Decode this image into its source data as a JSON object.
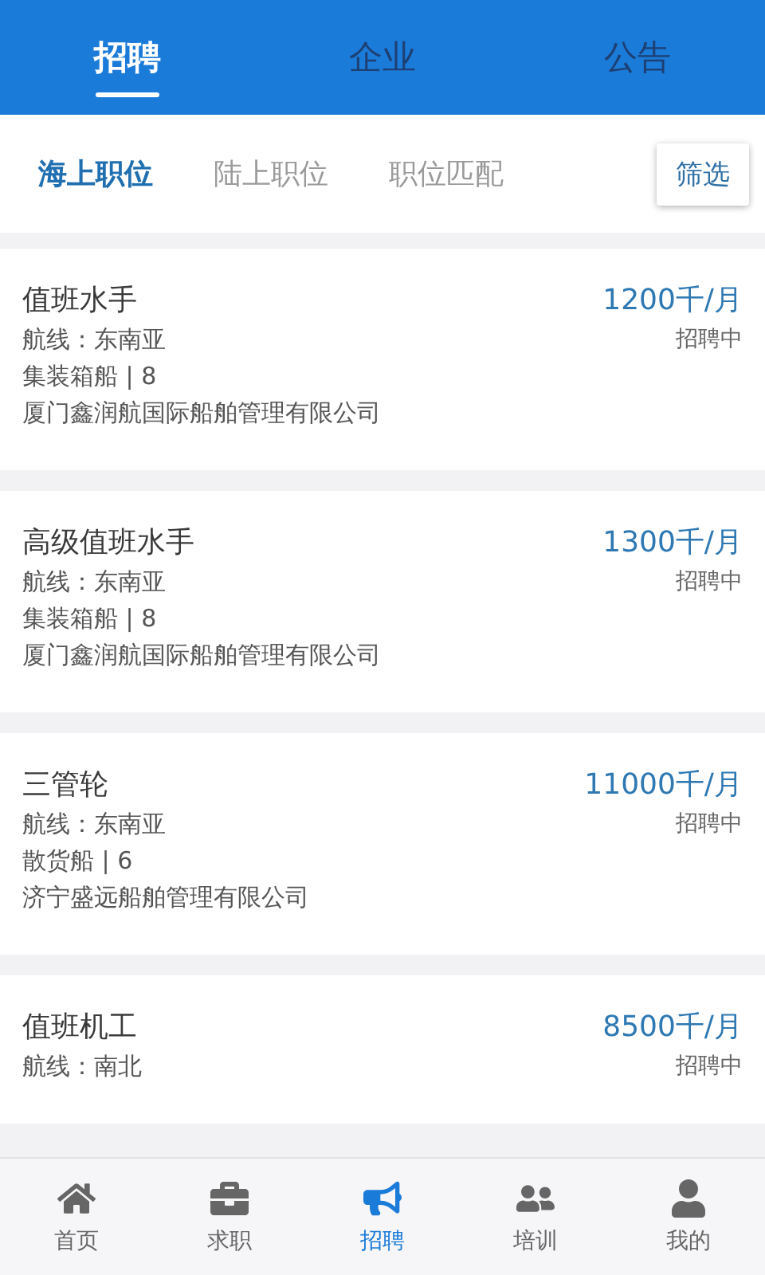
{
  "top_tabs": [
    {
      "label": "招聘",
      "selected": true
    },
    {
      "label": "企业",
      "selected": false
    },
    {
      "label": "公告",
      "selected": false
    }
  ],
  "sub_tabs": [
    {
      "label": "海上职位",
      "selected": true
    },
    {
      "label": "陆上职位",
      "selected": false
    },
    {
      "label": "职位匹配",
      "selected": false
    }
  ],
  "filter_button": "筛选",
  "jobs": [
    {
      "title": "值班水手",
      "salary": "1200千/月",
      "route": "航线：东南亚",
      "status": "招聘中",
      "vessel": "集装箱船 | 8",
      "company": "厦门鑫润航国际船舶管理有限公司"
    },
    {
      "title": "高级值班水手",
      "salary": "1300千/月",
      "route": "航线：东南亚",
      "status": "招聘中",
      "vessel": "集装箱船 | 8",
      "company": "厦门鑫润航国际船舶管理有限公司"
    },
    {
      "title": "三管轮",
      "salary": "11000千/月",
      "route": "航线：东南亚",
      "status": "招聘中",
      "vessel": "散货船 | 6",
      "company": "济宁盛远船舶管理有限公司"
    },
    {
      "title": "值班机工",
      "salary": "8500千/月",
      "route": "航线：南北",
      "status": "招聘中"
    }
  ],
  "bottom_nav": [
    {
      "label": "首页",
      "kind": "home",
      "selected": false
    },
    {
      "label": "求职",
      "kind": "briefcase",
      "selected": false
    },
    {
      "label": "招聘",
      "kind": "megaphone",
      "selected": true
    },
    {
      "label": "培训",
      "kind": "people",
      "selected": false
    },
    {
      "label": "我的",
      "kind": "person",
      "selected": false
    }
  ]
}
